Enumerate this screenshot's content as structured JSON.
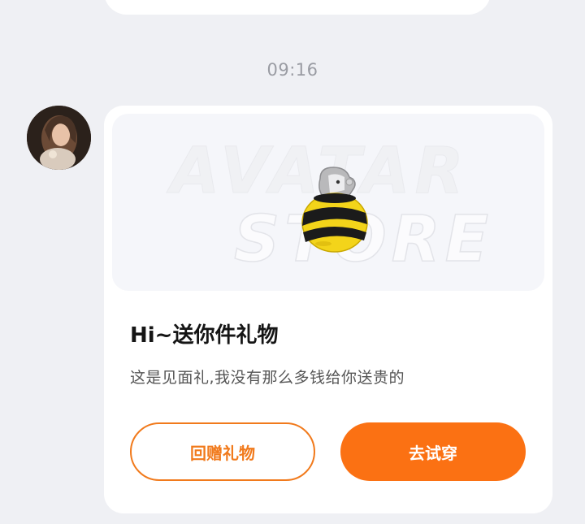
{
  "chat": {
    "timestamp": "09:16"
  },
  "message": {
    "banner": {
      "watermark_line1": "AVATAR",
      "watermark_line2": "STORE",
      "item_icon": "bee-ball-pet-icon"
    },
    "title": "Hi~送你件礼物",
    "description": "这是见面礼,我没有那么多钱给你送贵的",
    "buttons": {
      "return_gift": "回赠礼物",
      "try_on": "去试穿"
    }
  },
  "colors": {
    "accent": "#fb7113",
    "background": "#eff0f4",
    "card": "#ffffff"
  }
}
